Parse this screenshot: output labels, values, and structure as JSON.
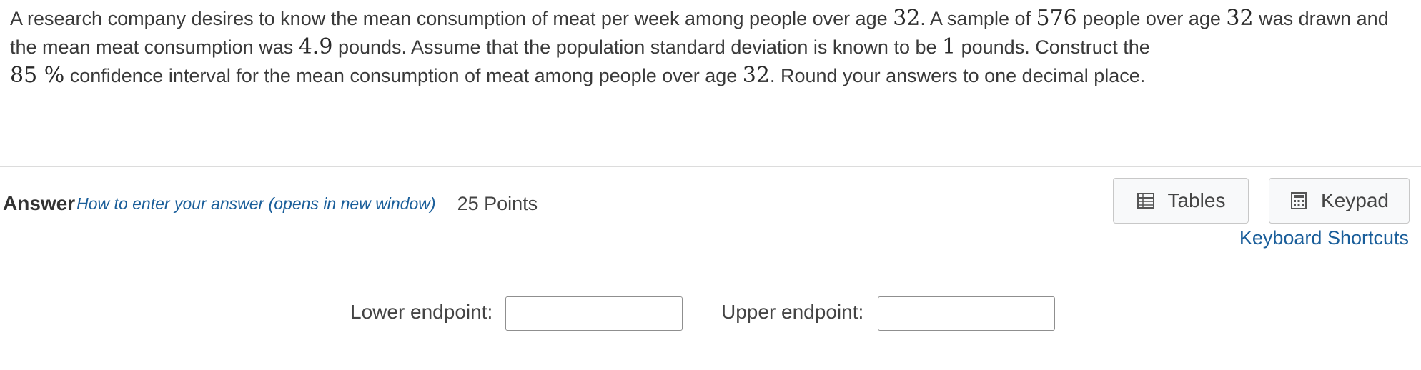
{
  "question": {
    "t1": "A research company desires to know the mean consumption of meat per week among people over age ",
    "age1": "32",
    "t2": ". A sample of ",
    "n": "576",
    "t3": " people over age ",
    "age2": "32",
    "t4": " was drawn and the mean meat consumption was ",
    "mean": "4.9",
    "t5": " pounds. Assume that the population standard deviation is known to be ",
    "sd": "1",
    "t6": " pounds. Construct the ",
    "conf": "85 %",
    "t7": " confidence interval for the mean consumption of meat among people over age ",
    "age3": "32",
    "t8": ". Round your answers to one decimal place."
  },
  "answer": {
    "title": "Answer",
    "howto": "How to enter your answer (opens in new window)",
    "points": "25 Points"
  },
  "tools": {
    "tables_label": "Tables",
    "tables_icon": "table-grid-icon",
    "keypad_label": "Keypad",
    "keypad_icon": "calculator-icon",
    "shortcuts_label": "Keyboard Shortcuts"
  },
  "fields": {
    "lower_label": "Lower endpoint:",
    "lower_value": "",
    "upper_label": "Upper endpoint:",
    "upper_value": ""
  }
}
